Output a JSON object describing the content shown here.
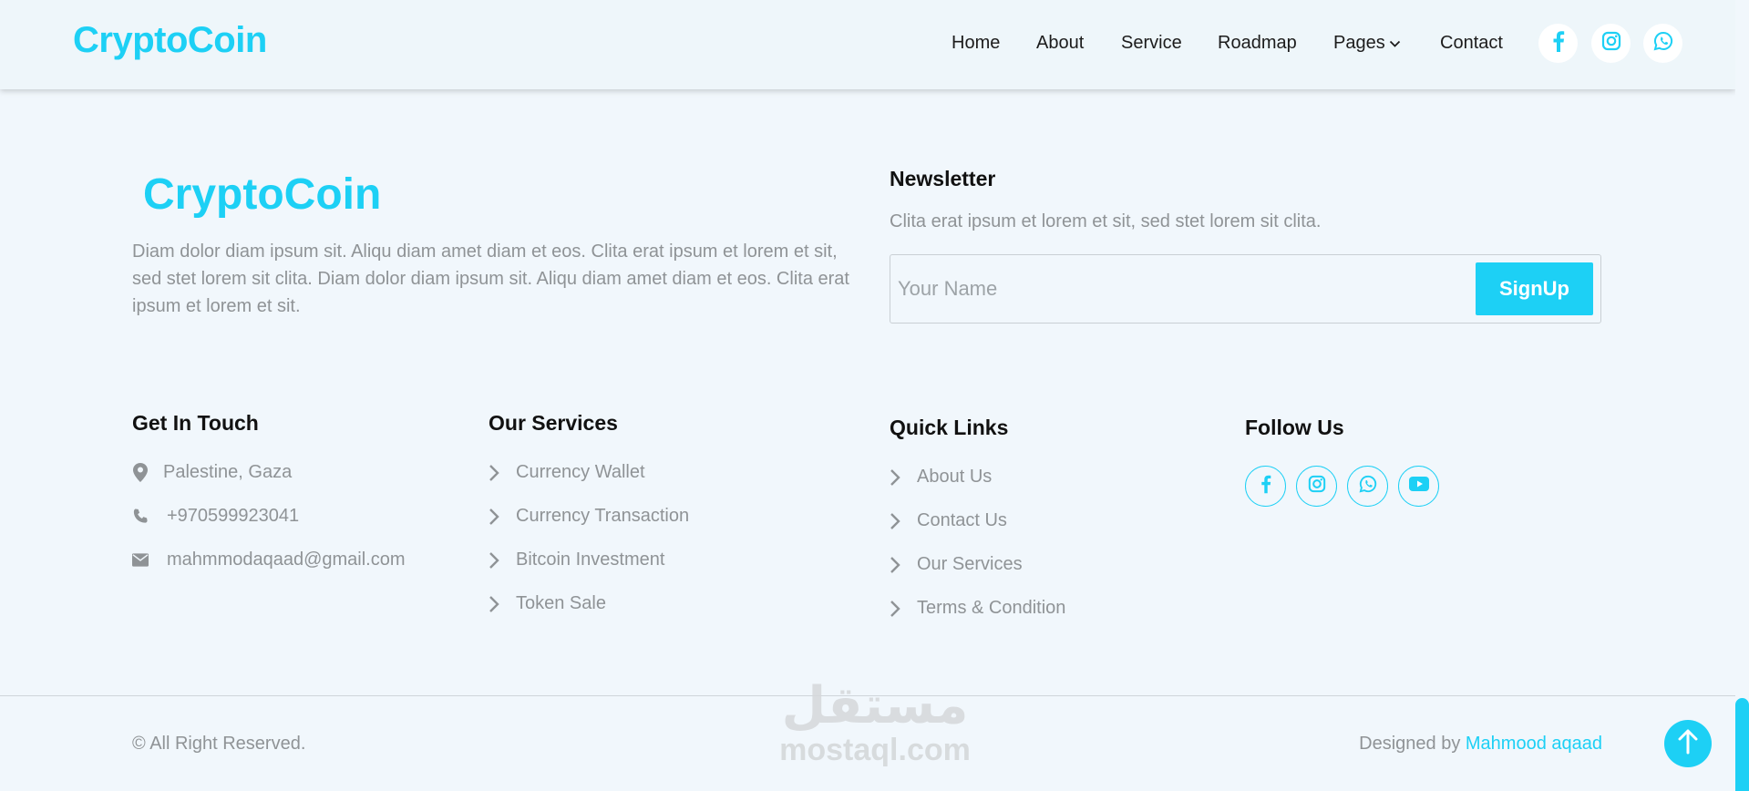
{
  "navbar": {
    "brand": "CryptoCoin",
    "links": [
      "Home",
      "About",
      "Service",
      "Roadmap",
      "Pages",
      "Contact"
    ],
    "social_icons": [
      "facebook-icon",
      "instagram-icon",
      "whatsapp-icon"
    ]
  },
  "footer": {
    "brand": "CryptoCoin",
    "about_text": "Diam dolor diam ipsum sit. Aliqu diam amet diam et eos. Clita erat ipsum et lorem et sit, sed stet lorem sit clita. Diam dolor diam ipsum sit. Aliqu diam amet diam et eos. Clita erat ipsum et lorem et sit.",
    "newsletter": {
      "title": "Newsletter",
      "text": "Clita erat ipsum et lorem et sit, sed stet lorem sit clita.",
      "input_placeholder": "Your Name",
      "input_value": "",
      "button_label": "SignUp"
    },
    "get_in_touch": {
      "title": "Get In Touch",
      "address": "Palestine, Gaza",
      "phone": "+970599923041",
      "email": "mahmmodaqaad@gmail.com"
    },
    "our_services": {
      "title": "Our Services",
      "items": [
        "Currency Wallet",
        "Currency Transaction",
        "Bitcoin Investment",
        "Token Sale"
      ]
    },
    "quick_links": {
      "title": "Quick Links",
      "items": [
        "About Us",
        "Contact Us",
        "Our Services",
        "Terms & Condition"
      ]
    },
    "follow_us": {
      "title": "Follow Us",
      "icons": [
        "facebook-icon",
        "instagram-icon",
        "whatsapp-icon",
        "youtube-icon"
      ]
    }
  },
  "bottom": {
    "copyright": "© All Right Reserved.",
    "designed_by": "Designed by",
    "designer": "Mahmood aqaad"
  },
  "watermark": {
    "arabic": "مستقل",
    "latin": "mostaql.com"
  },
  "colors": {
    "accent": "#1dd0f5",
    "muted_text": "#8f9396",
    "background": "#f1f7fc"
  }
}
